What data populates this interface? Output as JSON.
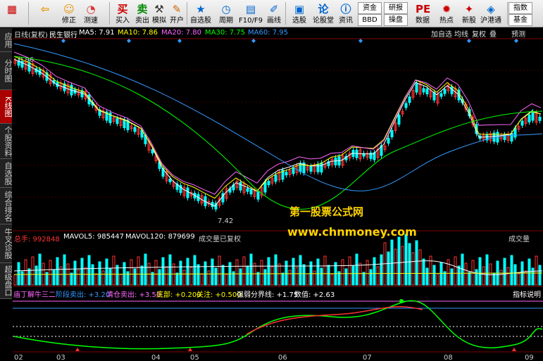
{
  "toolbar": {
    "buttons": [
      {
        "label": "",
        "icon": "grid-icon"
      },
      {
        "label": "",
        "icon": "back-arrow-icon"
      },
      {
        "label": "修正",
        "icon": "refresh-icon"
      },
      {
        "label": "测速",
        "icon": "speedometer-icon"
      },
      {
        "label": "买入",
        "icon": "buy-icon",
        "glyph": "买"
      },
      {
        "label": "卖出",
        "icon": "sell-icon",
        "glyph": "卖"
      },
      {
        "label": "模拟",
        "icon": "hammer-icon"
      },
      {
        "label": "开户",
        "icon": "pencil-icon"
      },
      {
        "label": "自选股",
        "icon": "star-icon"
      },
      {
        "label": "周期",
        "icon": "clock-icon"
      },
      {
        "label": "F10/F9",
        "icon": "document-icon"
      },
      {
        "label": "画线",
        "icon": "draw-pen-icon"
      },
      {
        "label": "选股",
        "icon": "screen-icon"
      },
      {
        "label": "论股堂",
        "icon": "forum-icon",
        "glyph": "论"
      },
      {
        "label": "资讯",
        "icon": "info-icon"
      },
      {
        "label": "数据",
        "icon": "pe-icon",
        "glyph": "PE"
      },
      {
        "label": "热点",
        "icon": "hot-icon"
      },
      {
        "label": "新股",
        "icon": "new-stock-icon"
      },
      {
        "label": "沪港通",
        "icon": "hk-icon"
      }
    ],
    "small_buttons": [
      "资金",
      "BBD",
      "研报",
      "操盘",
      "指数",
      "基金"
    ]
  },
  "sidebar": {
    "tabs": [
      "应用",
      "分时图",
      "K线图",
      "个股资料",
      "自选股",
      "综合排名",
      "牛叉诊股",
      "超级盘口"
    ],
    "active_index": 2
  },
  "chart_header": {
    "period": "日线(复权)",
    "stock_name": "民生银行",
    "ma5": "MA5: 7.91",
    "ma10": "MA10: 7.86",
    "ma20": "MA20: 7.80",
    "ma30": "MA30: 7.75",
    "ma60": "MA60: 7.95",
    "right_buttons": [
      "加自选",
      "均线",
      "复权",
      "叠",
      "预测"
    ]
  },
  "price_labels": {
    "high": "8.96",
    "low": "7.42"
  },
  "volume_header": {
    "total": "总手: 992848",
    "vol5": "MAVOL5: 985447",
    "vol120": "MAVOL120: 879699",
    "note": "成交量已复权",
    "dropdown": "成交量"
  },
  "indicator_header": {
    "name": "庙丁解牛三二",
    "stage_sell": "阶段卖出: +3.20",
    "clear_sell": "清仓卖出: +3.50",
    "bottom": "底部: +0.200",
    "focus": "关注: +0.500",
    "strength": "强弱分界线: +1.75",
    "value": "数值: +2.63",
    "help": "指标说明"
  },
  "x_axis": [
    "02",
    "03",
    "04",
    "05",
    "06",
    "07",
    "08",
    "09"
  ],
  "watermark": {
    "line1": "第一股票公式网",
    "line2": "www.chnmoney.com"
  },
  "colors": {
    "up": "#ff3333",
    "down": "#00ffff",
    "ma5": "#ffffff",
    "ma10": "#ffff00",
    "ma20": "#ff66ff",
    "ma30": "#00ff00",
    "ma60": "#3399ff"
  }
}
